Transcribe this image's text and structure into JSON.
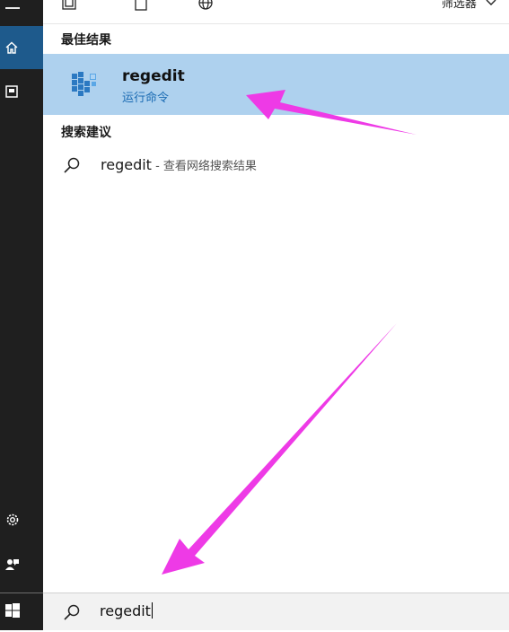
{
  "topbar": {
    "filter_label": "筛选器",
    "icons": [
      "apps-icon",
      "document-icon",
      "web-icon",
      "chevron-down-icon"
    ]
  },
  "rail": {
    "items": [
      "home-icon",
      "documents-icon",
      "settings-icon",
      "feedback-icon",
      "windows-start-icon"
    ],
    "active": "home-icon"
  },
  "best_match": {
    "heading": "最佳结果",
    "name": "regedit",
    "type": "运行命令"
  },
  "suggestions": {
    "heading": "搜索建议",
    "items": [
      {
        "query": "regedit",
        "suffix": " - 查看网络搜索结果"
      }
    ]
  },
  "search": {
    "value": "regedit"
  },
  "colors": {
    "rail_bg": "#1f1f1f",
    "rail_active": "#1e5a8c",
    "selection_bg": "#aed1ee",
    "subtitle_blue": "#1a6bb3",
    "annotation_arrow": "#ee3ae6"
  }
}
